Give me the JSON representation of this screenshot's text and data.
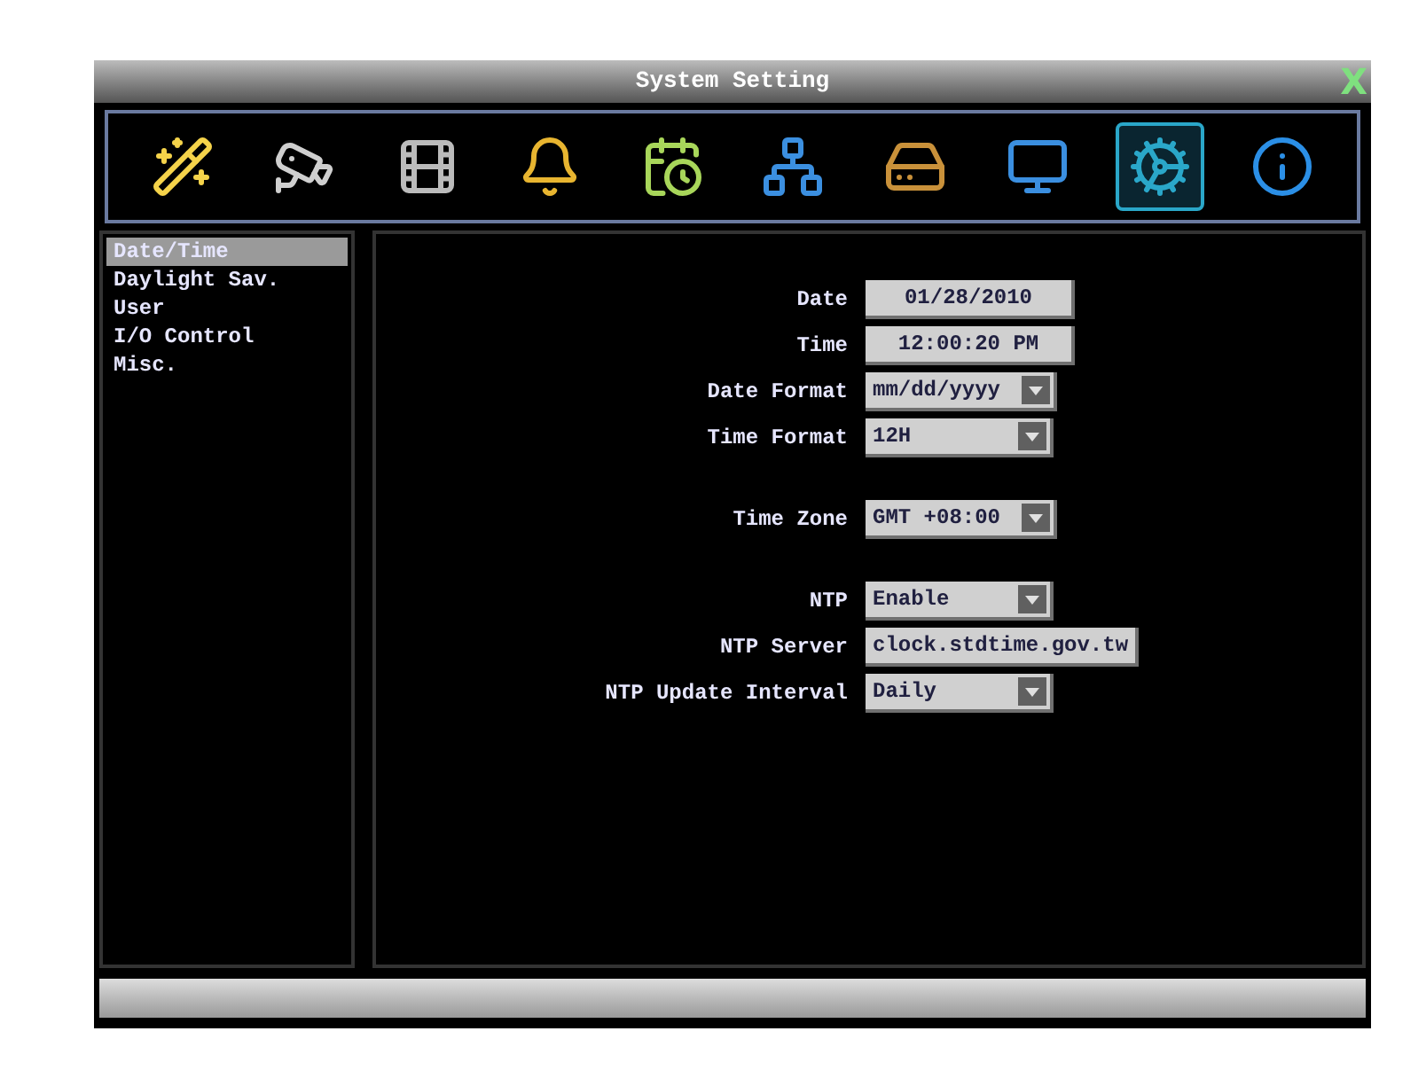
{
  "window": {
    "title": "System Setting",
    "close": "X"
  },
  "toolbar": [
    {
      "selected": false
    },
    {
      "selected": false
    },
    {
      "selected": false
    },
    {
      "selected": false
    },
    {
      "selected": false
    },
    {
      "selected": false
    },
    {
      "selected": false
    },
    {
      "selected": false
    },
    {
      "selected": true
    },
    {
      "selected": false
    }
  ],
  "sidebar": {
    "items": [
      {
        "label": "Date/Time",
        "selected": true
      },
      {
        "label": "Daylight Sav.",
        "selected": false
      },
      {
        "label": "User",
        "selected": false
      },
      {
        "label": "I/O Control",
        "selected": false
      },
      {
        "label": "Misc.",
        "selected": false
      }
    ]
  },
  "groups": [
    [
      {
        "label": "Date",
        "kind": "button",
        "value": "01/28/2010"
      },
      {
        "label": "Time",
        "kind": "button",
        "value": "12:00:20 PM"
      },
      {
        "label": "Date Format",
        "kind": "select",
        "value": "mm/dd/yyyy"
      },
      {
        "label": "Time Format",
        "kind": "select",
        "value": "12H"
      }
    ],
    [
      {
        "label": "Time Zone",
        "kind": "select",
        "value": "GMT +08:00"
      }
    ],
    [
      {
        "label": "NTP",
        "kind": "select",
        "value": "Enable"
      },
      {
        "label": "NTP Server",
        "kind": "text",
        "value": "clock.stdtime.gov.tw"
      },
      {
        "label": "NTP Update Interval",
        "kind": "select",
        "value": "Daily"
      }
    ]
  ]
}
